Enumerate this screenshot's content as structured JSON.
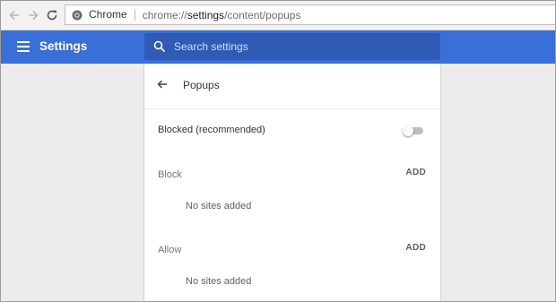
{
  "browser": {
    "chip_label": "Chrome",
    "url_scheme": "chrome://",
    "url_host": "settings",
    "url_path": "/content/popups"
  },
  "header": {
    "title": "Settings",
    "search_placeholder": "Search settings"
  },
  "page": {
    "title": "Popups",
    "toggle": {
      "label": "Blocked (recommended)",
      "state": "off"
    },
    "sections": [
      {
        "label": "Block",
        "add_label": "ADD",
        "empty_text": "No sites added"
      },
      {
        "label": "Allow",
        "add_label": "ADD",
        "empty_text": "No sites added"
      }
    ]
  },
  "colors": {
    "header_bg": "#3b6fd8",
    "search_bg": "#2f5bb4",
    "page_bg": "#ececec",
    "card_bg": "#ffffff"
  },
  "icons": {
    "back": "back-arrow-icon",
    "forward": "forward-arrow-icon",
    "reload": "reload-icon",
    "chrome": "chrome-logo-icon",
    "menu": "hamburger-menu-icon",
    "search": "search-icon",
    "page_back": "arrow-left-icon"
  }
}
